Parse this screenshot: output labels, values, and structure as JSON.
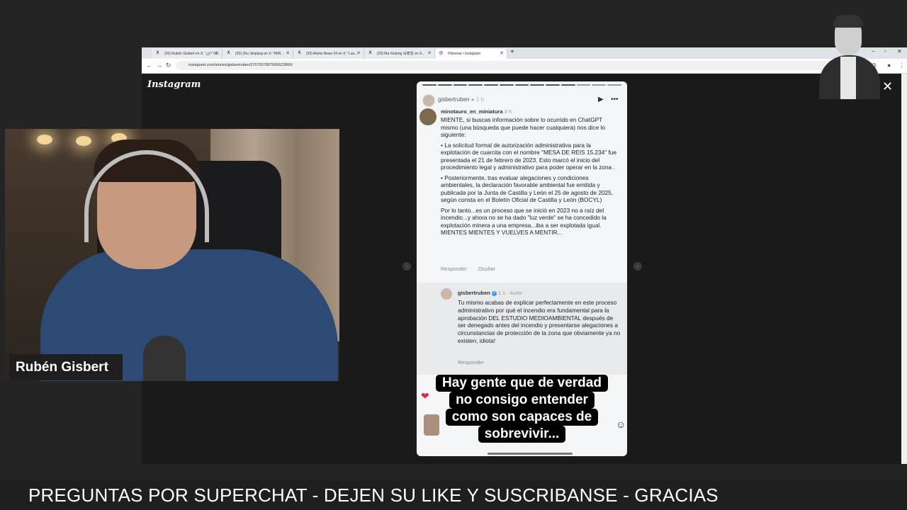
{
  "browser": {
    "tabs": [
      {
        "label": "(20) Rubén Gisbert en X: \"¿y? Ya...",
        "icon": "X"
      },
      {
        "label": "(20) Zhu Jieqiang en X: \"MIR...",
        "icon": "X"
      },
      {
        "label": "(20) Alerta News 24 en X: \"Las...",
        "icon": "X"
      },
      {
        "label": "(20) Ma Xiulong 马修龙 en X...",
        "icon": "X"
      },
      {
        "label": "Historias • Instagram",
        "icon": "◎"
      }
    ],
    "new_tab": "+",
    "url": "instagram.com/stories/gisbertruben/3707937807605623866/"
  },
  "instagram": {
    "logo": "Instagram",
    "close": "✕"
  },
  "story": {
    "user": "gisbertruben",
    "time": "1 h",
    "comment": {
      "user": "minotauro_en_miniatura",
      "time": "3 h",
      "p1": "MIENTE, si buscas información sobre lo ocurrido en ChatGPT mismo (una búsqueda que puede hacer cualquiera) nos dice lo siguiente:",
      "p2": "• La solicitud formal de autorización administrativa para la explotación de cuarcita con el nombre \"MESA DE REIS 15.234\" fue presentada el 21 de febrero de 2023. Esto marcó el inicio del procedimiento legal y administrativo para poder operar en la zona .",
      "p3": "• Posteriormente, tras evaluar alegaciones y condiciones ambientales, la declaración favorable ambiental fue emitida y publicada por la Junta de Castilla y León el 25 de agosto de 2025, según consta en el Boletín Oficial de Castilla y León (BOCYL)",
      "p4": "Por lo tanto...es un proceso que se inició en 2023 no a raíz del incendio...y ahora no se ha dado \"luz verde\" se ha concedido la explotación minera a una empresa...iba a ser explotada igual. MIENTES MIENTES Y VUELVES A MENTIR...",
      "reply_label": "Responder",
      "hide_label": "Ocultar"
    },
    "reply": {
      "user": "gisbertruben",
      "time": "1 s",
      "role": "Autor",
      "text": "Tu mismo acabas de explicar perfectamente en este proceso administrativo por qué el incendio era fundamental para la aprobación DEL ESTUDIO MEDIOAMBIENTAL después de ser denegado antes del incendio y presentarse alegaciones a circunstancias de protección de la zona que obviamente ya no existen, idiota!",
      "reply_label": "Responder"
    },
    "caption": [
      "Hay gente que de verdad",
      "no consigo entender",
      "como son capaces de",
      "sobrevivir..."
    ]
  },
  "webcam": {
    "name": "Rubén Gisbert"
  },
  "ticker": {
    "text": "PREGUNTAS POR SUPERCHAT - DEJEN SU LIKE Y SUSCRIBANSE - GRACIAS"
  }
}
